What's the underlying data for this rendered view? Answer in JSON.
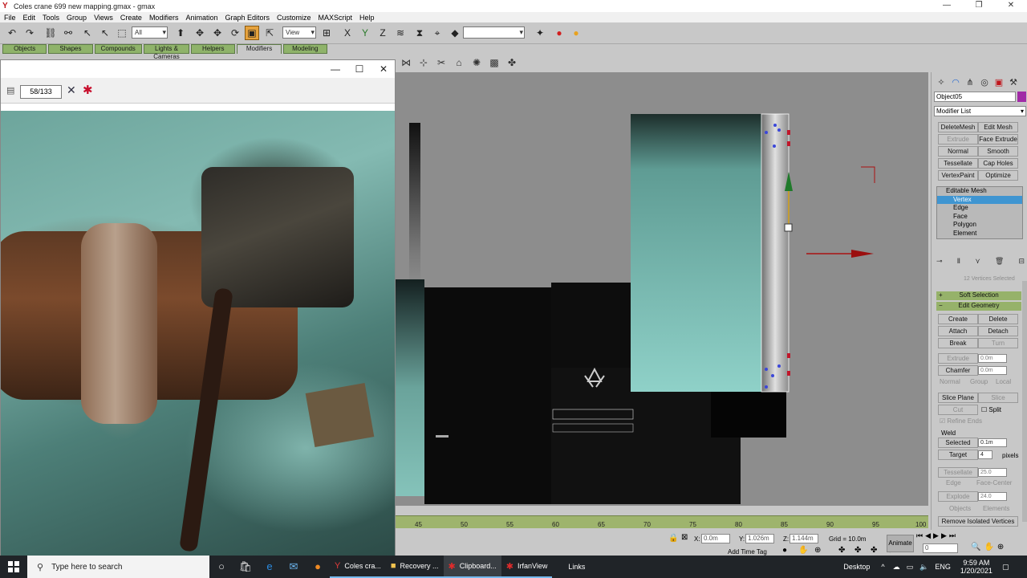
{
  "window": {
    "title": "Coles crane 699 new mapping.gmax - gmax",
    "minimize": "—",
    "maximize": "❐",
    "close": "✕"
  },
  "menu": [
    "File",
    "Edit",
    "Tools",
    "Group",
    "Views",
    "Create",
    "Modifiers",
    "Animation",
    "Graph Editors",
    "Customize",
    "MAXScript",
    "Help"
  ],
  "toolbar": {
    "selection_filter": "All",
    "ref_coord": "View",
    "named_selection": ""
  },
  "tabs": [
    "Objects",
    "Shapes",
    "Compounds",
    "Lights & Cameras",
    "Helpers",
    "Modifiers",
    "Modeling"
  ],
  "irfanview": {
    "minimize": "—",
    "maximize": "☐",
    "close": "✕",
    "counter": "58/133"
  },
  "ruler": {
    "ticks": [
      "45",
      "50",
      "55",
      "60",
      "65",
      "70",
      "75",
      "80",
      "85",
      "90",
      "95",
      "100"
    ]
  },
  "status": {
    "x_label": "X:",
    "x_value": "0.0m",
    "y_label": "Y:",
    "y_value": "1.026m",
    "z_label": "Z:",
    "z_value": "1.144m",
    "grid": "Grid = 10.0m",
    "add_time_tag": "Add Time Tag",
    "animate": "Animate",
    "frame": "0"
  },
  "command_panel": {
    "object_name": "Object05",
    "object_color": "#a12aa6",
    "modifier_list": "Modifier List",
    "modifier_buttons": [
      {
        "label": "DeleteMesh",
        "enabled": true
      },
      {
        "label": "Edit Mesh",
        "enabled": true
      },
      {
        "label": "Extrude",
        "enabled": false
      },
      {
        "label": "Face Extrude",
        "enabled": true
      },
      {
        "label": "Normal",
        "enabled": true
      },
      {
        "label": "Smooth",
        "enabled": true
      },
      {
        "label": "Tessellate",
        "enabled": true
      },
      {
        "label": "Cap Holes",
        "enabled": true
      },
      {
        "label": "VertexPaint",
        "enabled": true
      },
      {
        "label": "Optimize",
        "enabled": true
      }
    ],
    "stack": {
      "root": "Editable Mesh",
      "items": [
        "Vertex",
        "Edge",
        "Face",
        "Polygon",
        "Element"
      ],
      "selected": "Vertex"
    },
    "selected_info": "12 Vertices Selected",
    "soft_selection": "Soft Selection",
    "edit_geometry": "Edit Geometry",
    "geometry_buttons": {
      "create": "Create",
      "delete": "Delete",
      "attach": "Attach",
      "detach": "Detach",
      "break": "Break",
      "turn": "Turn",
      "extrude": "Extrude",
      "extrude_value": "0.0m",
      "chamfer": "Chamfer",
      "chamfer_value": "0.0m",
      "normal": "Normal",
      "group": "Group",
      "local": "Local",
      "slice_plane": "Slice Plane",
      "slice": "Slice",
      "cut": "Cut",
      "split": "Split",
      "refine_ends": "Refine Ends",
      "weld": "Weld",
      "selected": "Selected",
      "selected_value": "0.1m",
      "target": "Target",
      "target_value": "4",
      "pixels": "pixels",
      "tessellate": "Tessellate",
      "tessellate_value": "25.0",
      "by_edge": "Edge",
      "face_center": "Face-Center",
      "explode": "Explode",
      "explode_value": "24.0",
      "to_objects": "Objects",
      "to_elements": "Elements",
      "remove_isolated": "Remove Isolated Vertices"
    }
  },
  "taskbar": {
    "search_placeholder": "Type here to search",
    "apps": [
      {
        "label": "Coles cra...",
        "icon": "gmax-icon",
        "color": "#e23b3b",
        "glyph": "Y"
      },
      {
        "label": "Recovery ...",
        "icon": "folder-icon",
        "color": "#f2c44f",
        "glyph": "■"
      },
      {
        "label": "Clipboard...",
        "icon": "irfanview-icon",
        "color": "#e02b2b",
        "glyph": "✱"
      },
      {
        "label": "IrfanView",
        "icon": "irfanview-icon",
        "color": "#e02b2b",
        "glyph": "✱"
      }
    ],
    "links": "Links",
    "desktop": "Desktop",
    "lang": "ENG",
    "time": "9:59 AM",
    "date": "1/20/2021"
  }
}
